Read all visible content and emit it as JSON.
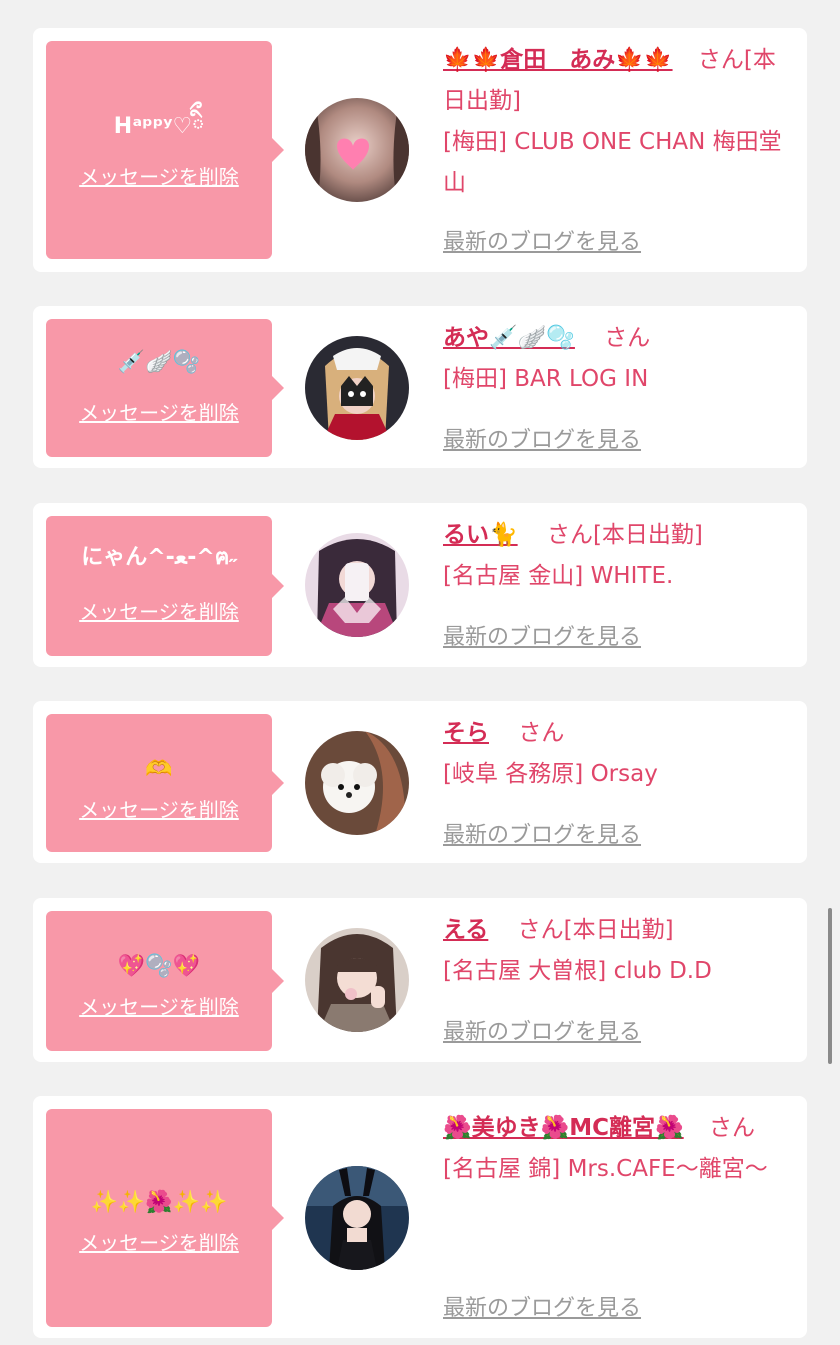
{
  "delete_label": "メッセージを削除",
  "blog_label": "最新のブログを見る",
  "san_label": "さん",
  "entries": [
    {
      "message": "Hᵃᵖᵖʸ♡ིྀ",
      "name": "🍁🍁倉田　あみ🍁🍁",
      "status": "[本日出勤]",
      "location": "[梅田] CLUB ONE CHAN 梅田堂山"
    },
    {
      "message": "💉🪽🫧",
      "name": "あや💉🪽🫧",
      "status": "",
      "location": "[梅田] BAR LOG IN"
    },
    {
      "message": "にゃん^-ﻌ-^ฅ˶",
      "name": "るい🐈",
      "status": "[本日出勤]",
      "location": "[名古屋 金山] WHITE."
    },
    {
      "message": "🫶",
      "name": "そら",
      "status": "",
      "location": "[岐阜 各務原] Orsay"
    },
    {
      "message": "💖🫧💖",
      "name": "える",
      "status": "[本日出勤]",
      "location": "[名古屋 大曽根] club D.D"
    },
    {
      "message": "✨✨🌺✨✨",
      "name": "🌺美ゆき🌺MC離宮🌺",
      "status": "",
      "location": "[名古屋 錦] Mrs.CAFE〜離宮〜"
    }
  ]
}
